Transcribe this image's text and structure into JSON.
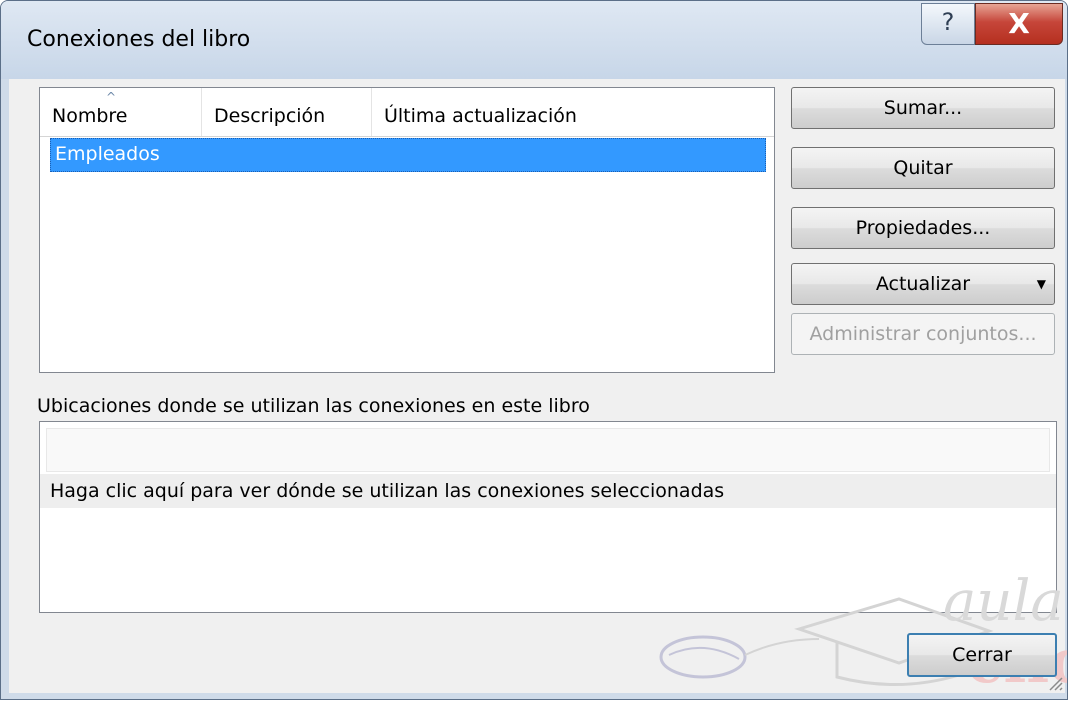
{
  "window": {
    "title": "Conexiones del libro",
    "help_glyph": "?",
    "close_glyph": "X"
  },
  "connections": {
    "columns": [
      "Nombre",
      "Descripción",
      "Última actualización"
    ],
    "sort_indicator": "^",
    "rows": [
      {
        "name": "Empleados",
        "description": "",
        "last_refreshed": "",
        "selected": true
      }
    ]
  },
  "buttons": {
    "add": "Sumar...",
    "remove": "Quitar",
    "properties": "Propiedades...",
    "refresh": "Actualizar",
    "refresh_arrow": "▼",
    "manage_sets": "Administrar conjuntos...",
    "manage_sets_enabled": false,
    "close": "Cerrar"
  },
  "locations": {
    "label": "Ubicaciones donde se utilizan las conexiones en este libro",
    "hint_row": "Haga clic aquí para ver dónde se utilizan las conexiones seleccionadas"
  },
  "watermark": {
    "word1": "aula",
    "word2": "clic",
    "suffix": "com"
  },
  "colors": {
    "selection": "#3399ff",
    "close_button": "#c6463a",
    "titlebar": "#d4e0ee"
  }
}
